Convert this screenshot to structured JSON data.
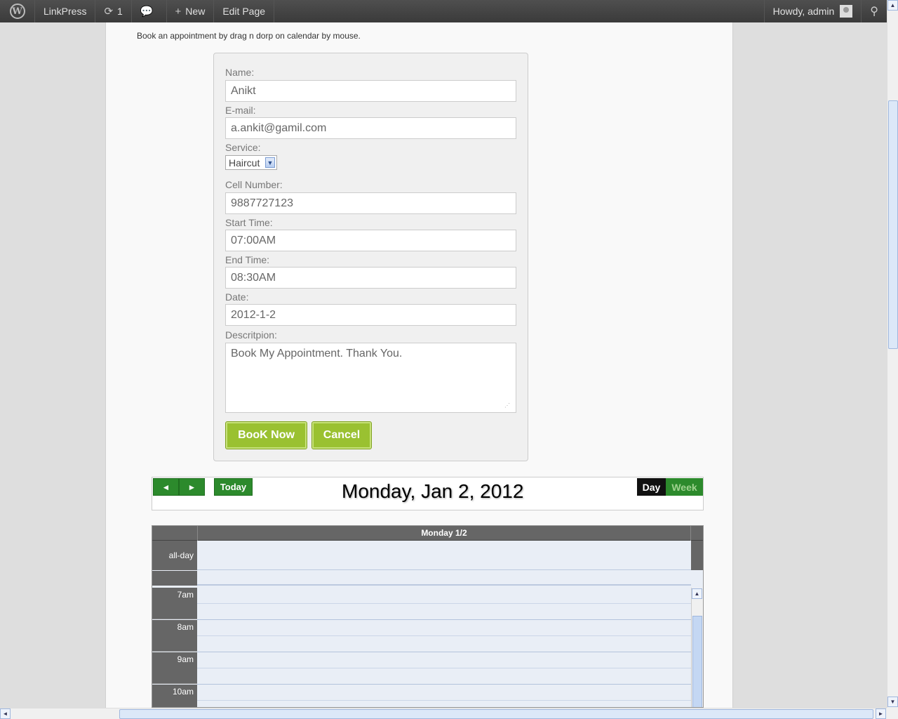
{
  "adminbar": {
    "site_name": "LinkPress",
    "updates_count": "1",
    "new_label": "New",
    "edit_label": "Edit Page",
    "greeting": "Howdy, admin"
  },
  "intro_text": "Book an appointment by drag n dorp on calendar by mouse.",
  "form": {
    "name_label": "Name:",
    "name_value": "Anikt",
    "email_label": "E-mail:",
    "email_value": "a.ankit@gamil.com",
    "service_label": "Service:",
    "service_value": "Haircut",
    "cell_label": "Cell Number:",
    "cell_value": "9887727123",
    "start_label": "Start Time:",
    "start_value": "07:00AM",
    "end_label": "End Time:",
    "end_value": "08:30AM",
    "date_label": "Date:",
    "date_value": "2012-1-2",
    "desc_label": "Descritpion:",
    "desc_value": "Book My Appointment. Thank You.",
    "book_button": "BooK Now",
    "cancel_button": "Cancel"
  },
  "calendar": {
    "prev": "◄",
    "next": "►",
    "today": "Today",
    "title": "Monday, Jan 2, 2012",
    "day_view": "Day",
    "week_view": "Week",
    "column_header": "Monday 1/2",
    "allday_label": "all-day",
    "hours": [
      "7am",
      "8am",
      "9am",
      "10am"
    ]
  },
  "colors": {
    "button_green": "#9ac131",
    "nav_green": "#2c8a2c",
    "grid_blue": "#e9eef6"
  }
}
